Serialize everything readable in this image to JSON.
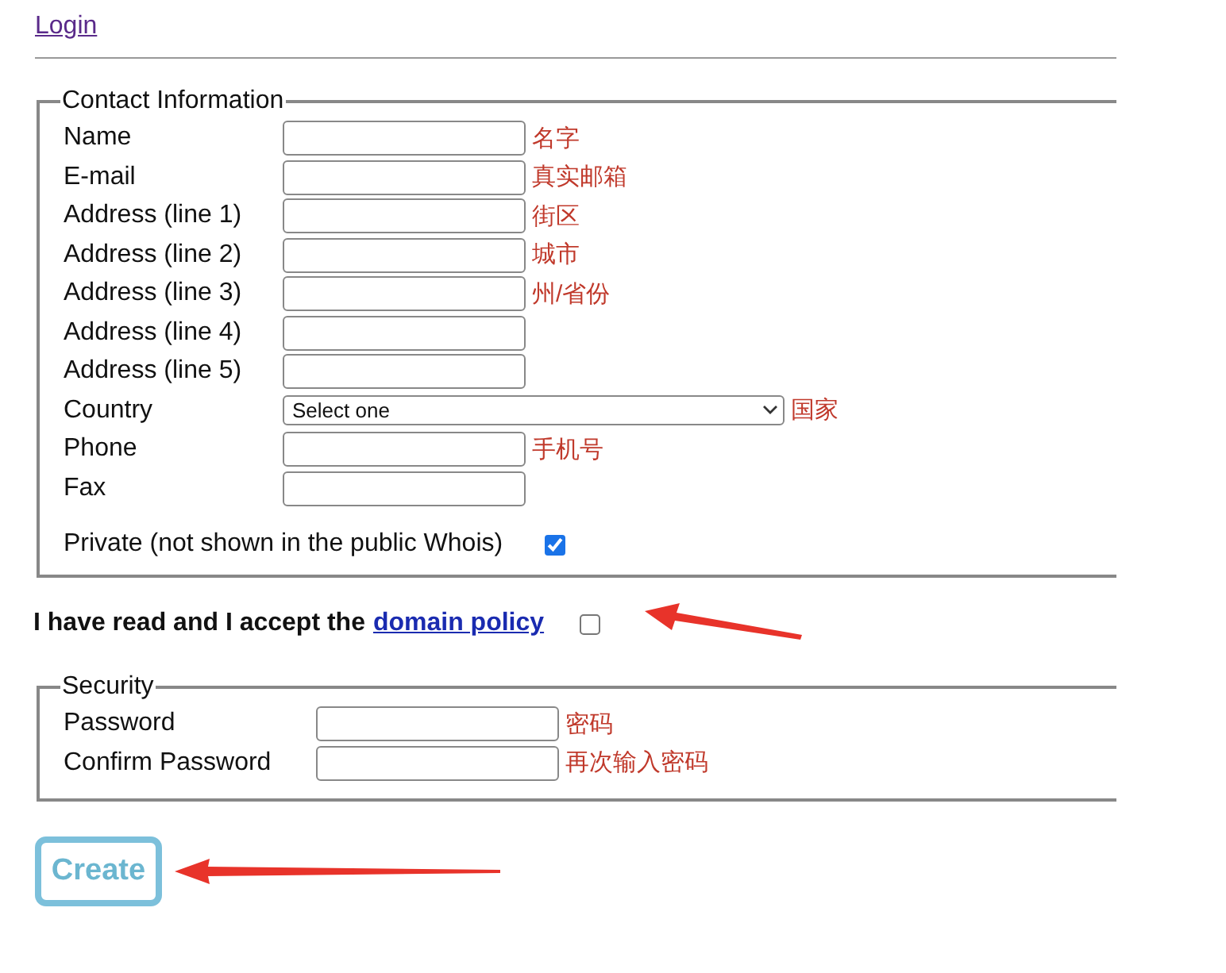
{
  "login_link": "Login",
  "contact": {
    "legend": "Contact Information",
    "fields": [
      {
        "kind": "text",
        "label": "Name",
        "note": "名字"
      },
      {
        "kind": "text",
        "label": "E-mail",
        "note": "真实邮箱"
      },
      {
        "kind": "text",
        "label": "Address (line 1)",
        "note": "街区"
      },
      {
        "kind": "text",
        "label": "Address (line 2)",
        "note": "城市"
      },
      {
        "kind": "text",
        "label": "Address (line 3)",
        "note": "州/省份"
      },
      {
        "kind": "text",
        "label": "Address (line 4)"
      },
      {
        "kind": "text",
        "label": "Address (line 5)"
      },
      {
        "kind": "select",
        "label": "Country",
        "value": "Select one",
        "note": "国家"
      },
      {
        "kind": "text",
        "label": "Phone",
        "note": "手机号"
      },
      {
        "kind": "text",
        "label": "Fax"
      }
    ],
    "private": {
      "label": "Private (not shown in the public Whois)",
      "checked": true
    }
  },
  "policy": {
    "text": "I have read and I accept the",
    "link": "domain policy",
    "checked": false
  },
  "security": {
    "legend": "Security",
    "fields": [
      {
        "label": "Password",
        "note": "密码"
      },
      {
        "label": "Confirm Password",
        "note": "再次输入密码"
      }
    ]
  },
  "create_button": "Create"
}
